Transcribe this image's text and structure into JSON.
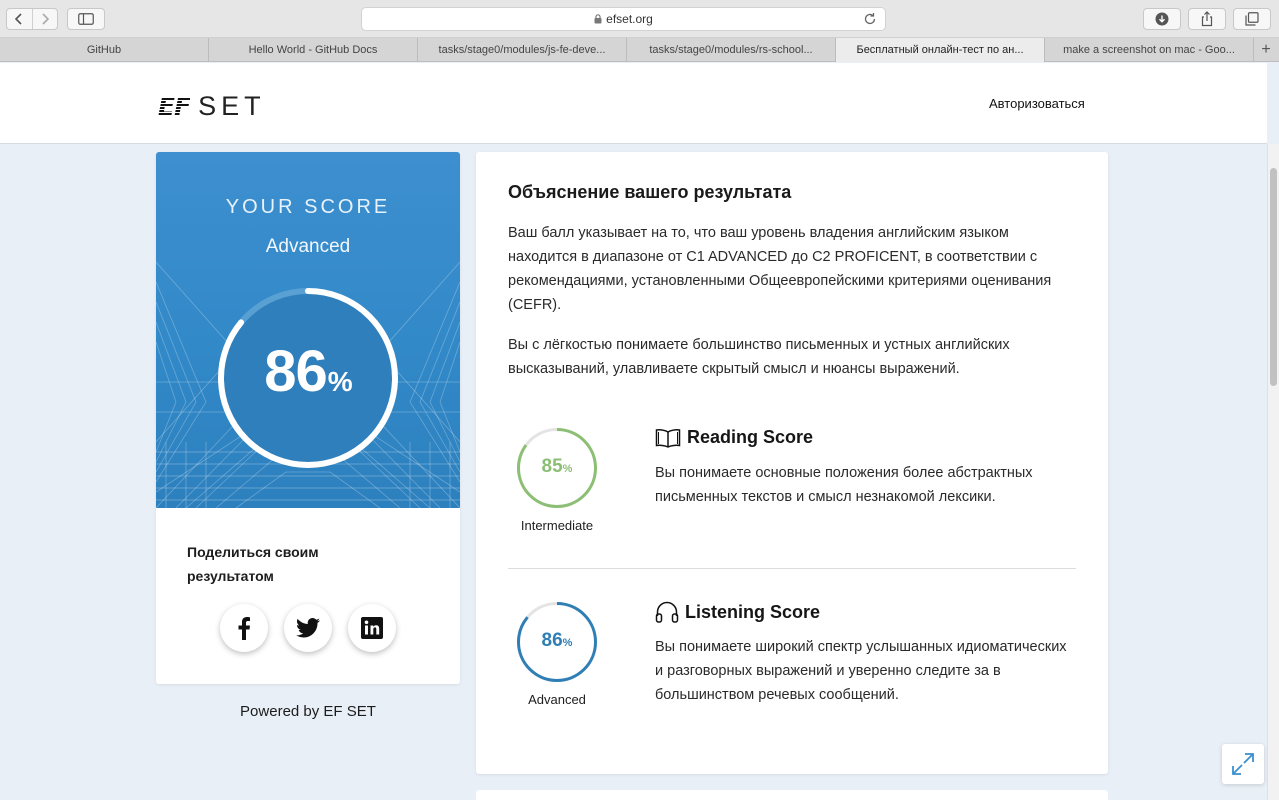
{
  "browser": {
    "url": "efset.org",
    "tabs": [
      {
        "label": "GitHub",
        "active": false
      },
      {
        "label": "Hello World - GitHub Docs",
        "active": false
      },
      {
        "label": "tasks/stage0/modules/js-fe-deve...",
        "active": false
      },
      {
        "label": "tasks/stage0/modules/rs-school...",
        "active": false
      },
      {
        "label": "Бесплатный онлайн-тест по ан...",
        "active": true
      },
      {
        "label": "make a screenshot on mac - Goo...",
        "active": false
      }
    ],
    "new_tab": "+"
  },
  "header": {
    "logo_ef": "EF",
    "logo_set": "SET",
    "login": "Авторизоваться"
  },
  "score": {
    "heading": "YOUR SCORE",
    "level": "Advanced",
    "value": "86",
    "percent_sign": "%",
    "fraction": 0.86
  },
  "share": {
    "title": "Поделиться своим результатом",
    "icons": [
      "facebook-icon",
      "twitter-icon",
      "linkedin-icon"
    ]
  },
  "powered_by": "Powered by EF SET",
  "explanation": {
    "title": "Объяснение вашего результата",
    "paragraph1": "Ваш балл указывает на то, что ваш уровень владения английским языком находится в диапазоне от C1 ADVANCED до C2 PROFICENT, в соответствии с рекомендациями, установленными Общеевропейскими критериями оценивания (CEFR).",
    "paragraph2": "Вы с лёгкостью понимаете большинство письменных и устных английских высказываний, улавливаете скрытый смысл и нюансы выражений."
  },
  "reading": {
    "title": "Reading Score",
    "value": "85",
    "percent_sign": "%",
    "fraction": 0.85,
    "level": "Intermediate",
    "description": "Вы понимаете основные положения более абстрактных письменных текстов и смысл незнакомой лексики.",
    "color": "#8cbf74",
    "icon": "book-icon"
  },
  "listening": {
    "title": "Listening Score",
    "value": "86",
    "percent_sign": "%",
    "fraction": 0.86,
    "level": "Advanced",
    "description": "Вы понимаете широкий спектр услышанных идиоматических и разговорных выражений и уверенно следите за в большинством речевых сообщений.",
    "color": "#2f7fb6",
    "icon": "headphones-icon"
  },
  "colors": {
    "hero_blue": "#3289c8",
    "page_bg": "#e9eff6"
  }
}
